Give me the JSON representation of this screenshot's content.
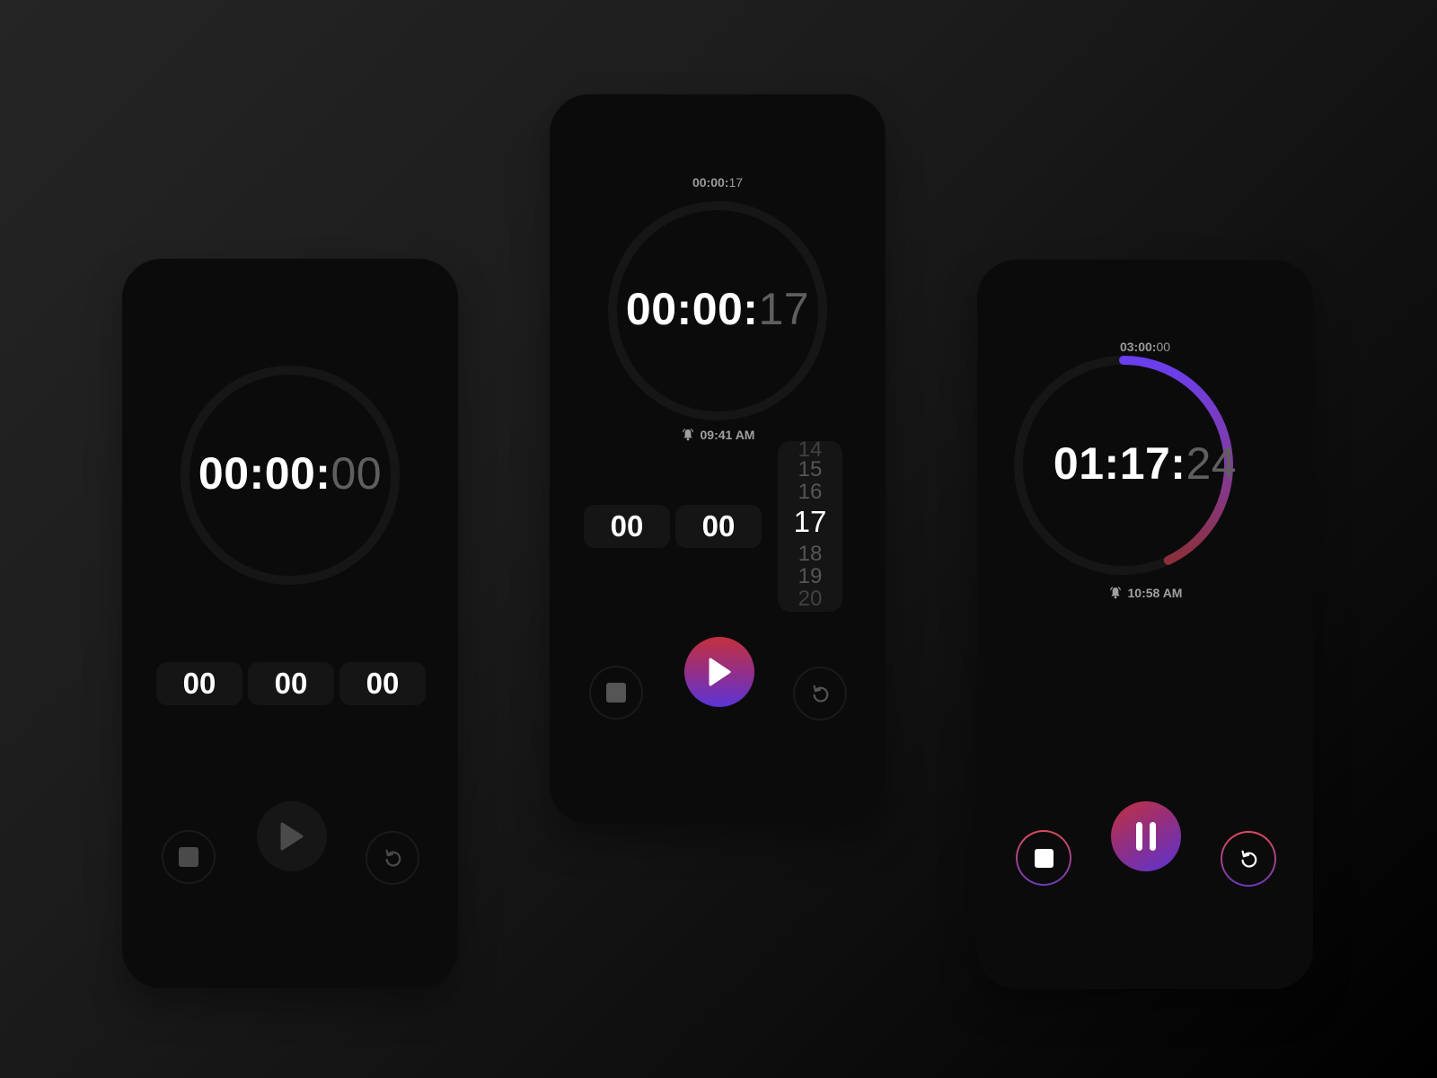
{
  "screens": [
    {
      "name": "idle",
      "main_time": {
        "hm": "00:00:",
        "sec": "00"
      },
      "inputs": {
        "hours": "00",
        "minutes": "00",
        "seconds": "00"
      },
      "controls": {
        "stop": "stop-icon",
        "play": "play-icon",
        "reset": "reset-icon"
      },
      "state": "disabled"
    },
    {
      "name": "setting",
      "preview_time": {
        "hm": "00:00:",
        "sec": "17"
      },
      "main_time": {
        "hm": "00:00:",
        "sec": "17"
      },
      "alarm_time": "09:41 AM",
      "inputs": {
        "hours": "00",
        "minutes": "00"
      },
      "seconds_picker": {
        "options": [
          "14",
          "15",
          "16",
          "17",
          "18",
          "19",
          "20"
        ],
        "selected": "17"
      },
      "controls": {
        "stop": "stop-icon",
        "play": "play-icon",
        "reset": "reset-icon"
      },
      "state": "ready"
    },
    {
      "name": "running",
      "total_time": {
        "hm": "03:00:",
        "sec": "00"
      },
      "main_time": {
        "hm": "01:17:",
        "sec": "24"
      },
      "alarm_time": "10:58 AM",
      "progress_remaining_fraction": 0.43,
      "controls": {
        "stop": "stop-icon",
        "pause": "pause-icon",
        "reset": "reset-icon"
      },
      "state": "running"
    }
  ],
  "colors": {
    "accent_start": "#c3303f",
    "accent_mid": "#8e2f8e",
    "accent_end": "#5b34d8",
    "ring_track": "#161616",
    "panel_bg": "#0b0b0b"
  }
}
